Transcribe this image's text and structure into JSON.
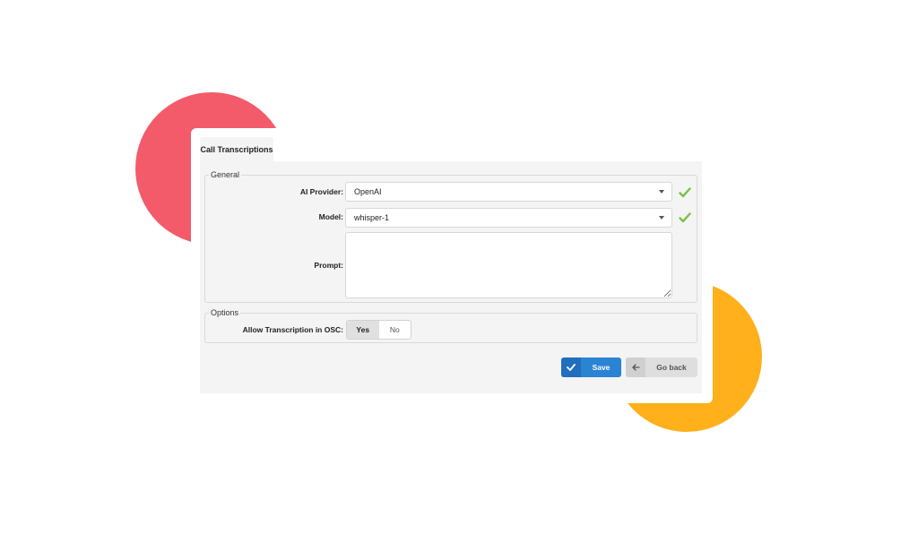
{
  "tab": {
    "label": "Call Transcriptions"
  },
  "general": {
    "legend": "General",
    "ai_provider": {
      "label": "AI Provider:",
      "value": "OpenAI",
      "status_icon": "check-icon"
    },
    "model": {
      "label": "Model:",
      "value": "whisper-1",
      "status_icon": "check-icon"
    },
    "prompt": {
      "label": "Prompt:",
      "value": ""
    }
  },
  "options": {
    "legend": "Options",
    "allow_transcription": {
      "label": "Allow Transcription in OSC:",
      "yes": "Yes",
      "no": "No",
      "selected": "Yes"
    }
  },
  "actions": {
    "save": "Save",
    "go_back": "Go back"
  },
  "colors": {
    "accent": "#2b83d4",
    "check": "#7ac142",
    "deco_red": "#f35b6a",
    "deco_yellow": "#ffb01a"
  }
}
